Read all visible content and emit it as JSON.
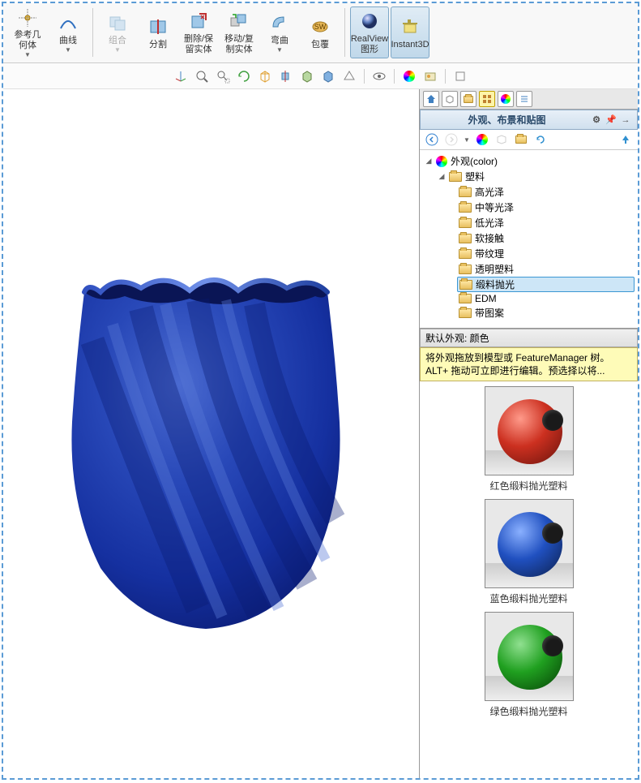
{
  "ribbon": {
    "ref_geom": "参考几\n何体",
    "curve": "曲线",
    "combine": "组合",
    "split": "分割",
    "delete_keep": "删除/保\n留实体",
    "move_copy": "移动/复\n制实体",
    "bend": "弯曲",
    "wrap": "包覆",
    "realview": "RealView\n图形",
    "instant3d": "Instant3D"
  },
  "panel": {
    "title": "外观、布景和贴图"
  },
  "tree": {
    "root": "外观(color)",
    "plastic": "塑料",
    "items": [
      "高光泽",
      "中等光泽",
      "低光泽",
      "软接触",
      "带纹理",
      "透明塑料",
      "缎料抛光",
      "EDM",
      "带图案"
    ]
  },
  "default_appearance": "默认外观: 颜色",
  "hint": "将外观拖放到模型或 FeatureManager 树。ALT+ 拖动可立即进行编辑。预选择以将...",
  "swatches": {
    "red": "红色缎料抛光塑料",
    "blue": "蓝色缎料抛光塑料",
    "green": "绿色缎料抛光塑料"
  }
}
